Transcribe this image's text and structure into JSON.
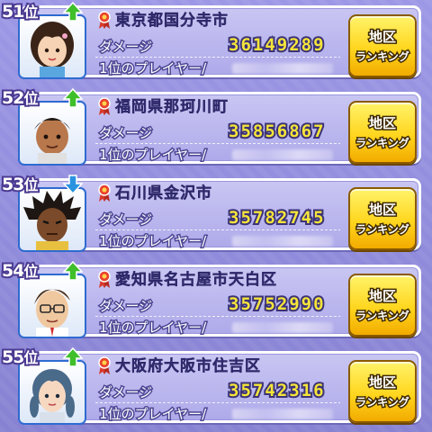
{
  "labels": {
    "damage": "ダメージ",
    "player": "1位のプレイヤー/",
    "button_line1": "地区",
    "button_line2": "ランキング"
  },
  "colors": {
    "background": "#8f8ad8",
    "panel": "#c0bcf0",
    "damage_value": "#f5e43a",
    "button": "#ffd61e",
    "arrow_up": "#3fbf2a",
    "arrow_down": "#2a93e0",
    "portrait_border": "#2e6bd0"
  },
  "rows": [
    {
      "rank_num": "51",
      "rank_suffix": "位",
      "trend": "up",
      "trend_icon": "green-up-arrow-icon",
      "place": "東京都国分寺市",
      "damage": "36149289",
      "player_name_hidden": true,
      "portrait": "girl-avatar"
    },
    {
      "rank_num": "52",
      "rank_suffix": "位",
      "trend": "up",
      "trend_icon": "green-up-arrow-icon",
      "place": "福岡県那珂川町",
      "damage": "35856867",
      "player_name_hidden": true,
      "portrait": "boy-avatar"
    },
    {
      "rank_num": "53",
      "rank_suffix": "位",
      "trend": "down",
      "trend_icon": "blue-down-arrow-icon",
      "place": "石川県金沢市",
      "damage": "35782745",
      "player_name_hidden": true,
      "portrait": "dreadlocks-avatar"
    },
    {
      "rank_num": "54",
      "rank_suffix": "位",
      "trend": "up",
      "trend_icon": "green-up-arrow-icon",
      "place": "愛知県名古屋市天白区",
      "damage": "35752990",
      "player_name_hidden": true,
      "portrait": "glasses-man-avatar"
    },
    {
      "rank_num": "55",
      "rank_suffix": "位",
      "trend": "up",
      "trend_icon": "green-up-arrow-icon",
      "place": "大阪府大阪市住吉区",
      "damage": "35742316",
      "player_name_hidden": true,
      "portrait": "braids-girl-avatar"
    }
  ]
}
